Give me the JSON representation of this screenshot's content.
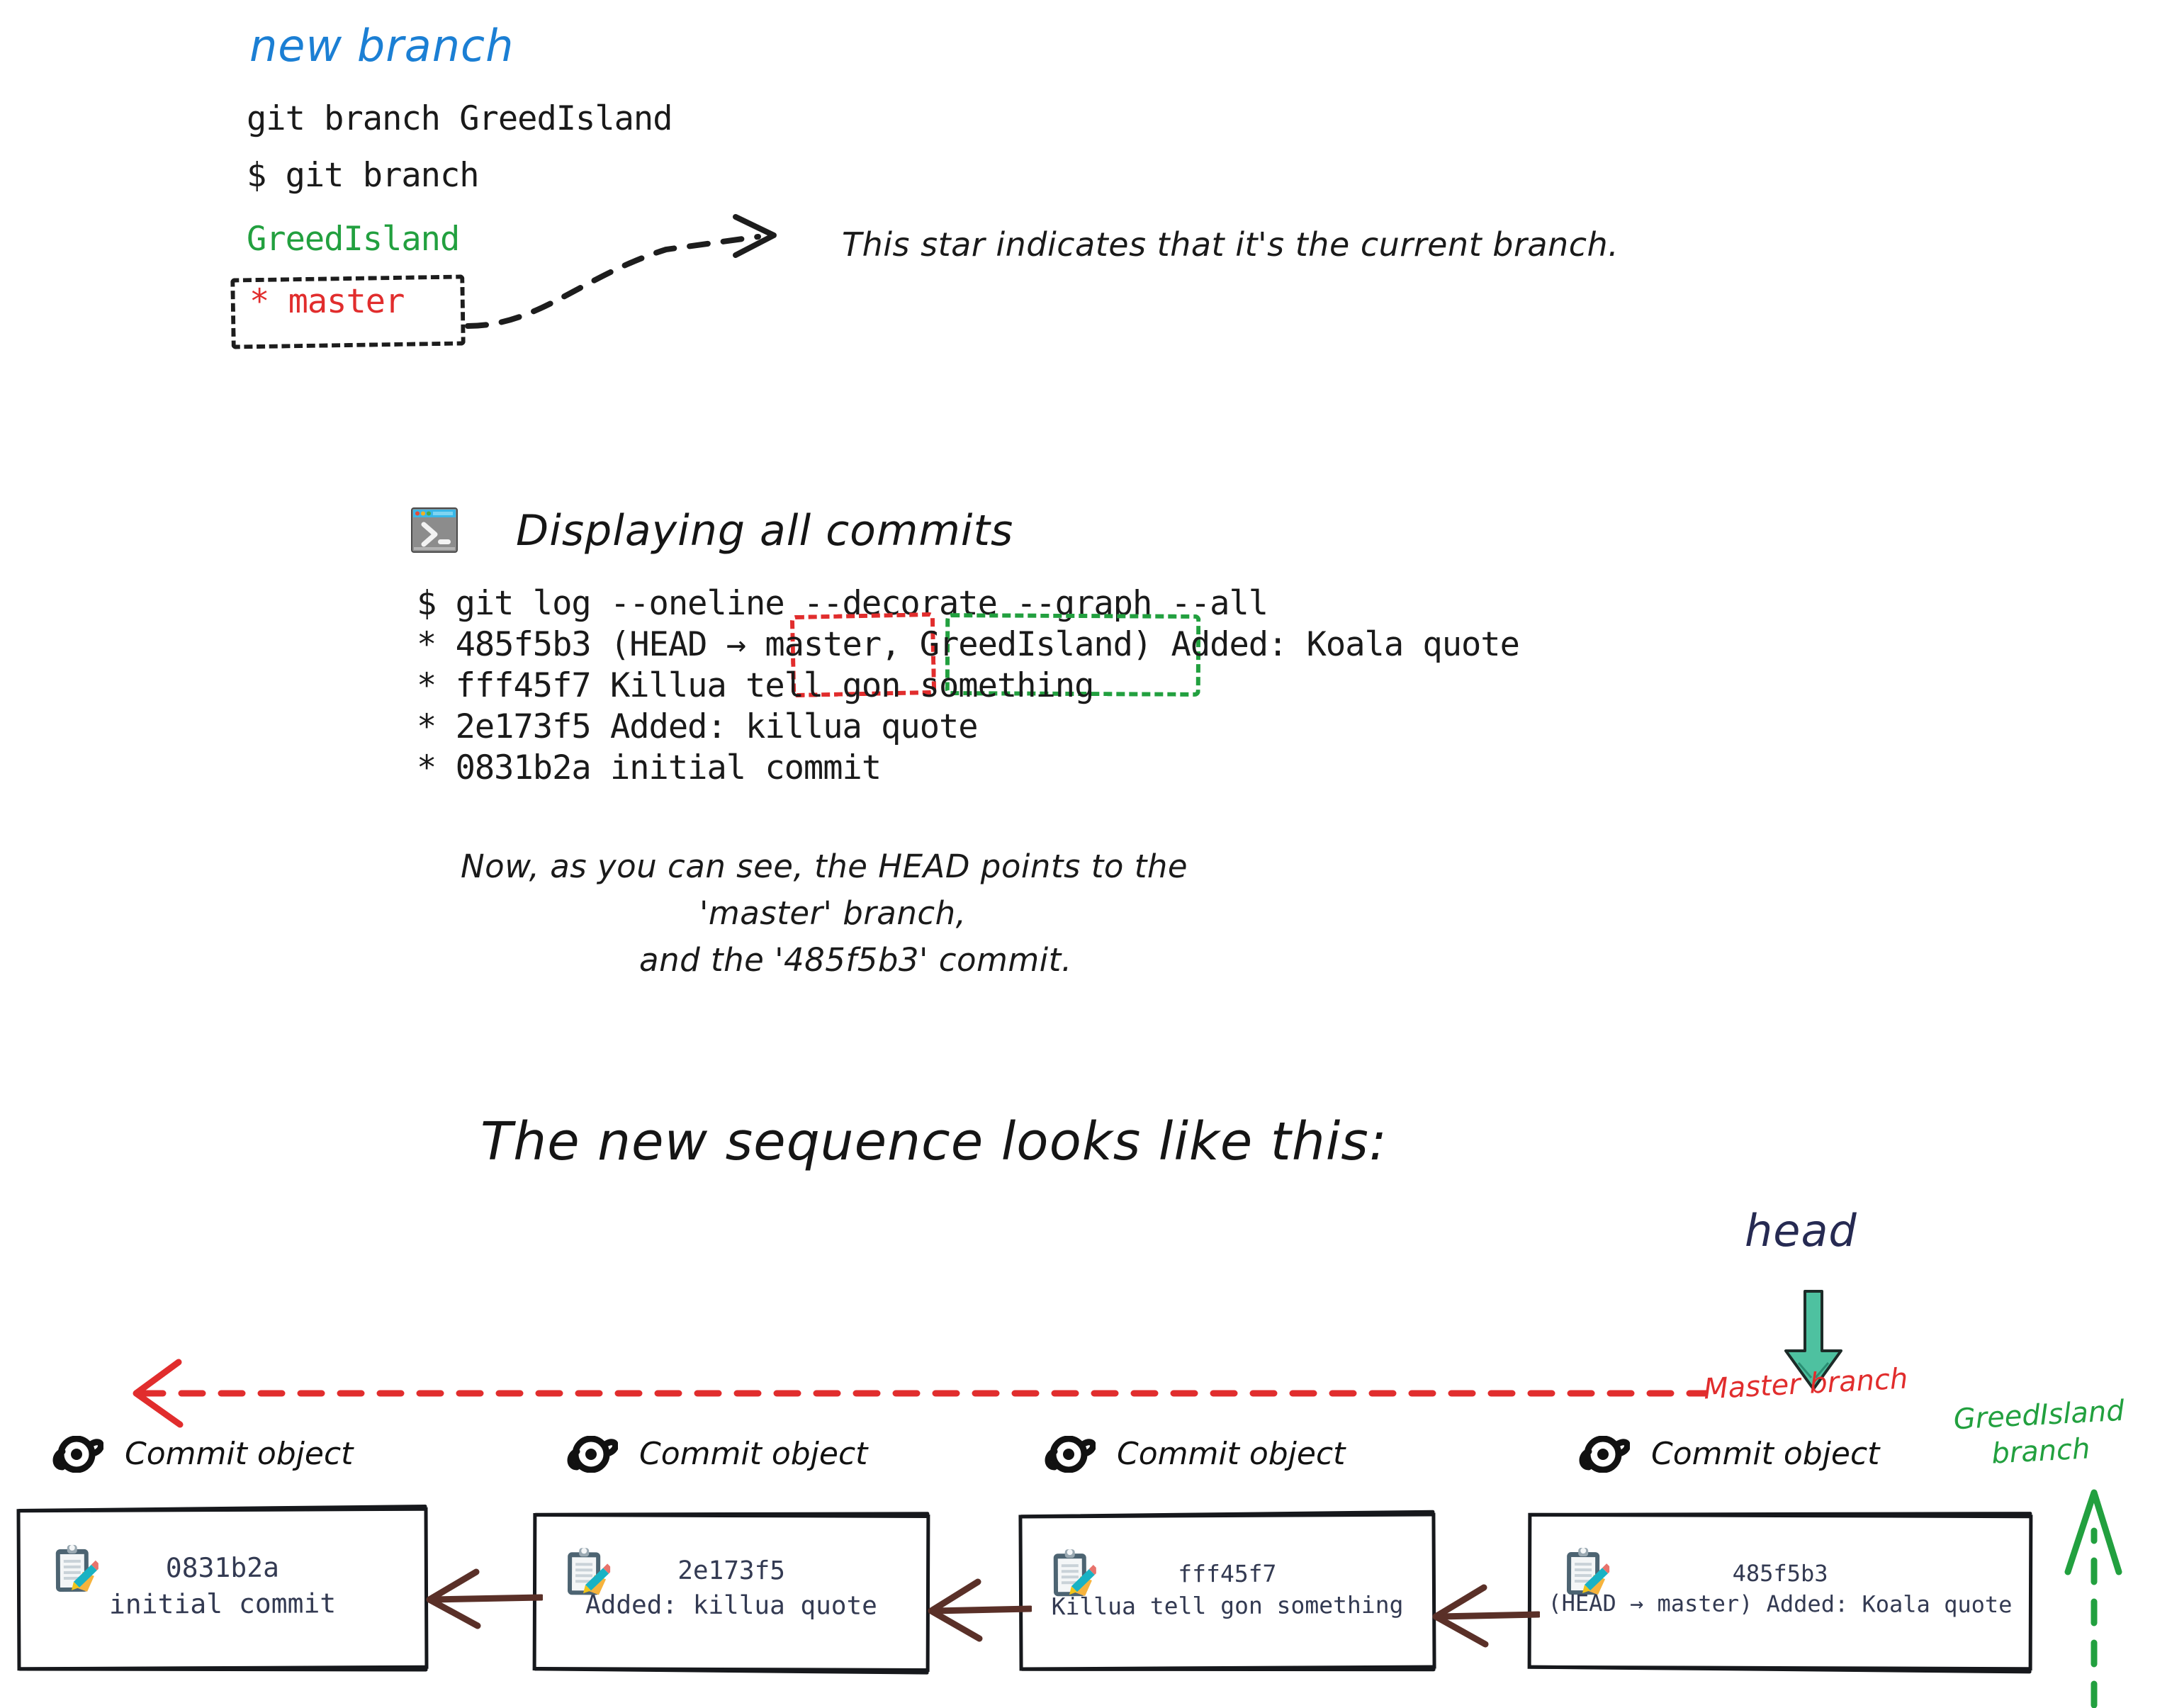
{
  "section1": {
    "title": "new branch",
    "commands": [
      "git branch GreedIsland",
      "$ git branch"
    ],
    "output": {
      "greedisland": "GreedIsland",
      "master": "* master"
    },
    "annotation": "This star indicates that it's the current branch.",
    "colors": {
      "title": "#1b7fd4",
      "branch_green": "#22a03f",
      "branch_red": "#e12d2d"
    }
  },
  "section2": {
    "icon": "terminal-icon",
    "title": "Displaying all commits",
    "log_lines": [
      "$ git log --oneline --decorate --graph --all",
      "* 485f5b3 (HEAD → master, GreedIsland) Added: Koala quote",
      "* fff45f7 Killua tell gon something",
      "* 2e173f5 Added: killua quote",
      "* 0831b2a initial commit"
    ],
    "highlight_master": "master",
    "highlight_greedisland": "GreedIsland",
    "note_lines": [
      "Now, as you can see, the HEAD points to the",
      "'master' branch,",
      "and the '485f5b3' commit."
    ]
  },
  "section3": {
    "title": "The new sequence looks like this:",
    "head_label": "head",
    "master_branch_label": "Master branch",
    "greedisland_branch_label_line1": "GreedIsland",
    "greedisland_branch_label_line2": "branch",
    "commit_object_label": "Commit object",
    "colors": {
      "head_arrow": "#4ec1a0",
      "head_text": "#262a52",
      "master_line": "#e12d2d",
      "greed_line": "#22a03f",
      "commit_arrow": "#5a3028",
      "commit_text": "#333a52"
    },
    "commits": [
      {
        "hash": "0831b2a",
        "message": "initial commit"
      },
      {
        "hash": "2e173f5",
        "message": "Added: killua quote"
      },
      {
        "hash": "fff45f7",
        "message": "Killua tell gon something"
      },
      {
        "hash": "485f5b3",
        "message": "(HEAD → master) Added: Koala quote"
      }
    ]
  }
}
